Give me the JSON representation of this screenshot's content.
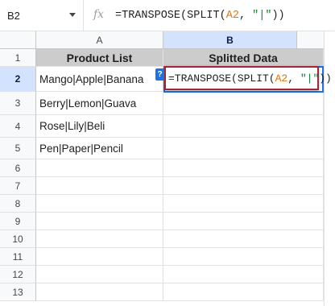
{
  "name_box": {
    "value": "B2"
  },
  "formula_bar": {
    "fx_icon": "function-icon",
    "formula_prefix": "=TRANSPOSE(SPLIT(",
    "formula_ref": "A2",
    "formula_mid": ", ",
    "formula_str": "\"|\"",
    "formula_suffix": "))"
  },
  "columns": [
    "A",
    "B"
  ],
  "rows": [
    "1",
    "2",
    "3",
    "4",
    "5",
    "6",
    "7",
    "8",
    "9",
    "10",
    "11",
    "12",
    "13"
  ],
  "selection": {
    "column": "B",
    "row": "2"
  },
  "sheet": {
    "header": {
      "col_a": "Product List",
      "col_b": "Splitted Data"
    },
    "products": [
      "Mango|Apple|Banana",
      "Berry|Lemon|Guava",
      "Rose|Lily|Beli",
      "Pen|Paper|Pencil"
    ]
  },
  "editor": {
    "formula_prefix": "=TRANSPOSE(SPLIT(",
    "formula_ref": "A2",
    "formula_mid": ", ",
    "formula_str": "\"|\"",
    "formula_suffix": "))",
    "help_label": "?"
  },
  "colors": {
    "header_fill": "#cccccc",
    "selection_blue": "#1a73e8",
    "editor_border": "#a0273a",
    "ref_orange": "#e8710a",
    "string_green": "#188038"
  }
}
